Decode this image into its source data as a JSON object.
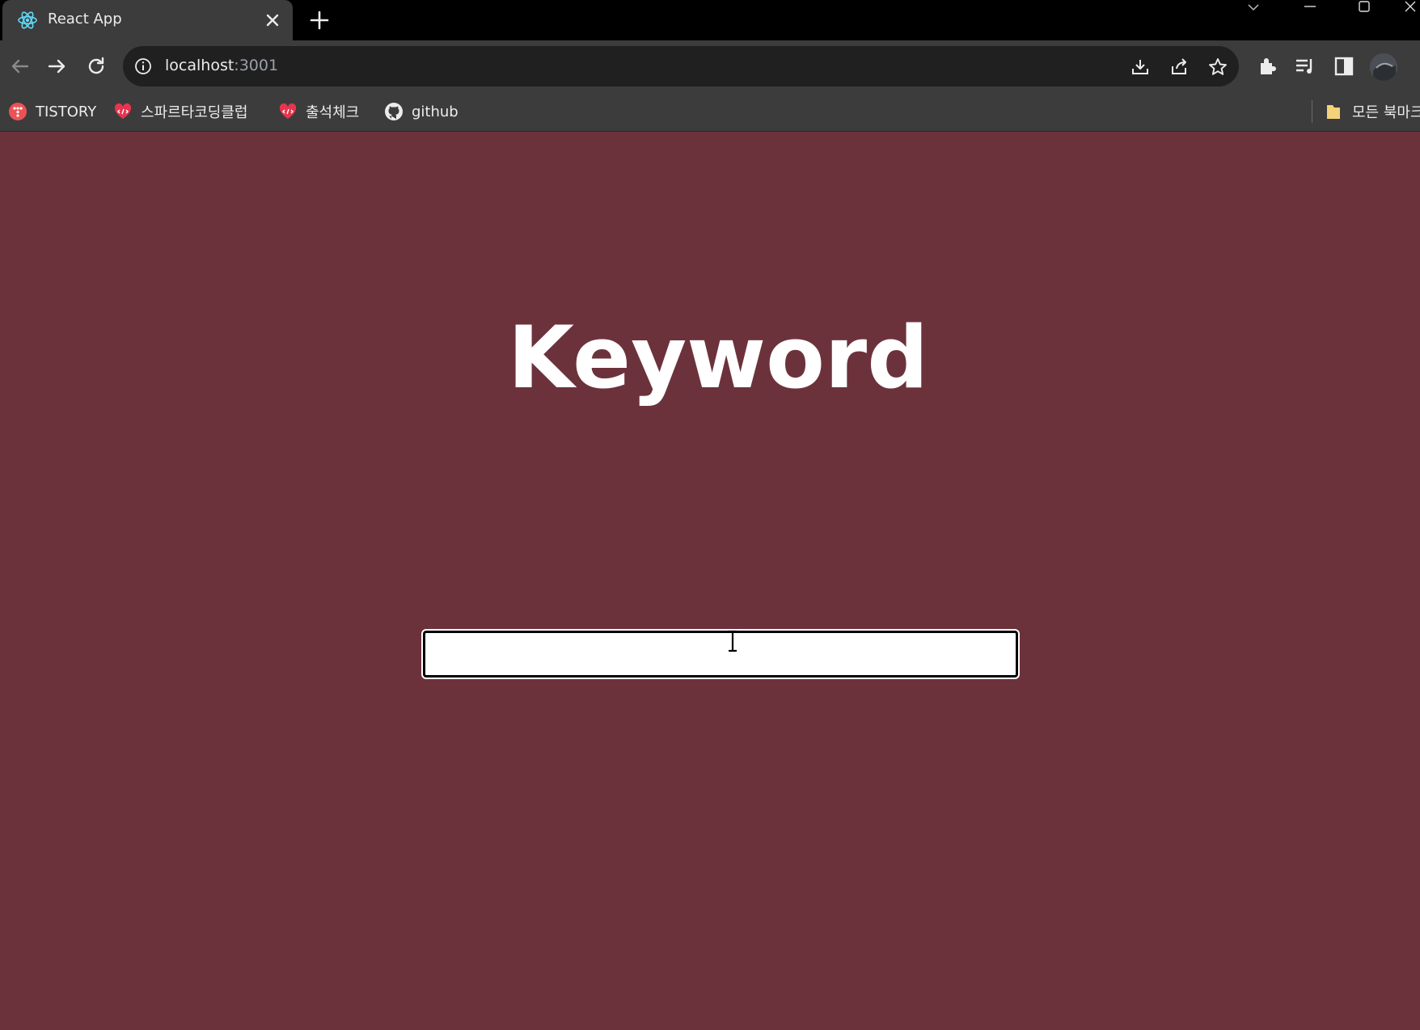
{
  "browser": {
    "tab": {
      "title": "React App",
      "favicon": "react-logo-icon"
    },
    "new_tab_icon": "plus-icon",
    "toolbar": {
      "url_host": "localhost",
      "url_port": ":3001"
    },
    "bookmarks": [
      {
        "label": "TISTORY",
        "icon": "tistory-icon"
      },
      {
        "label": "스파르타코딩클럽",
        "icon": "sparta-icon"
      },
      {
        "label": "출석체크",
        "icon": "sparta-icon"
      },
      {
        "label": "github",
        "icon": "github-icon"
      }
    ],
    "bookmark_folder": {
      "label": "모든 북마크",
      "icon": "folder-icon"
    }
  },
  "page": {
    "title": "Keyword",
    "search_value": "",
    "background_color": "#6c323c"
  }
}
